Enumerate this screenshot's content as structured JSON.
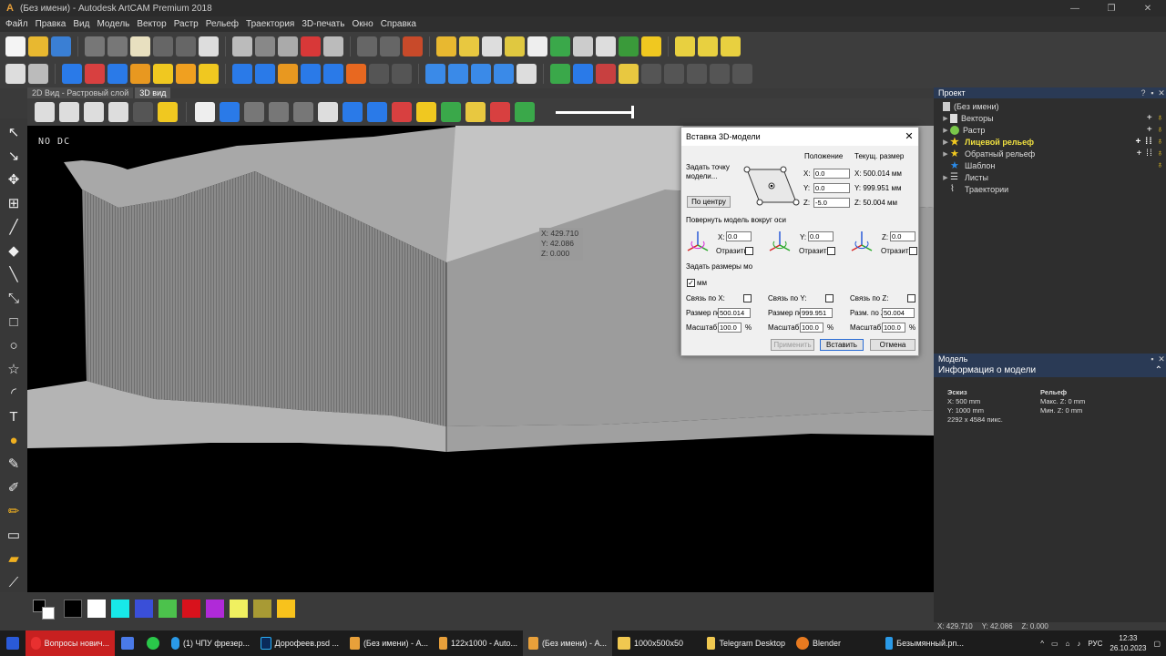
{
  "window": {
    "title": "(Без имени) - Autodesk ArtCAM Premium 2018",
    "minimize": "—",
    "maximize": "❐",
    "close": "✕"
  },
  "menu": [
    "Файл",
    "Правка",
    "Вид",
    "Модель",
    "Вектор",
    "Растр",
    "Рельеф",
    "Траектория",
    "3D-печать",
    "Окно",
    "Справка"
  ],
  "doc_tabs": [
    {
      "label": "2D Вид - Растровый слой"
    },
    {
      "label": "3D вид"
    }
  ],
  "viewport": {
    "label": "NO DC",
    "tooltip": {
      "x": "X: 429.710",
      "y": "Y: 42.086",
      "z": "Z: 0.000"
    }
  },
  "palette": {
    "colors": [
      "#ffffff",
      "#000000",
      "#ffffff",
      "#18e8e8",
      "#3a4fd8",
      "#4cc24c",
      "#d8121c",
      "#b02ad8",
      "#f0f060",
      "#a89a34",
      "#f8c21c"
    ]
  },
  "status": {
    "x": "X: 429.710",
    "y": "Y: 42.086",
    "z": "Z: 0.000"
  },
  "project": {
    "header": "Проект",
    "items": [
      {
        "label": "(Без имени)"
      },
      {
        "label": "Векторы"
      },
      {
        "label": "Растр"
      },
      {
        "label": "Лицевой рельеф"
      },
      {
        "label": "Обратный рельеф"
      },
      {
        "label": "Шаблон"
      },
      {
        "label": "Листы"
      },
      {
        "label": "Траектории"
      }
    ]
  },
  "model_panel": {
    "header": "Модель",
    "info_title": "Информация о модели",
    "sketch": {
      "title": "Эскиз",
      "x": "X: 500 mm",
      "y": "Y: 1000 mm",
      "pixels": "2292 x 4584 пикс."
    },
    "relief": {
      "title": "Рельеф",
      "max": "Макс. Z: 0 mm",
      "min": "Мин. Z: 0 mm"
    }
  },
  "dialog": {
    "title": "Вставка 3D-модели",
    "set_point": "Задать точку модели...",
    "center_btn": "По центру",
    "position_hdr": "Положение",
    "size_hdr": "Текущ. размер",
    "pos": {
      "x_lbl": "X:",
      "y_lbl": "Y:",
      "z_lbl": "Z:",
      "x": "0.0",
      "y": "0.0",
      "z": "-5.0"
    },
    "size": {
      "x": "X: 500.014 мм",
      "y": "Y: 999.951 мм",
      "z": "Z: 50.004 мм"
    },
    "rotate_lbl": "Повернуть модель вокруг оси",
    "rot": {
      "x_lbl": "X:",
      "y_lbl": "Y:",
      "z_lbl": "Z:",
      "x": "0.0",
      "y": "0.0",
      "z": "0.0",
      "mirror": "Отразить"
    },
    "dims_lbl": "Задать размеры мо",
    "mm_lbl": "мм",
    "link_x": "Связь по X:",
    "link_y": "Связь по Y:",
    "link_z": "Связь по Z:",
    "size_x_lbl": "Размер по",
    "size_y_lbl": "Размер по",
    "size_z_lbl": "Разм. по Z",
    "size_x": "500.014",
    "size_y": "999.951",
    "size_z": "50.004",
    "scale_lbl": "Масштаб г",
    "scale_x": "100.0",
    "scale_y": "100.0",
    "scale_z": "100.0",
    "pct": "%",
    "apply": "Применить",
    "insert": "Вставить",
    "cancel": "Отмена"
  },
  "taskbar": {
    "items": [
      {
        "label": "Вопросы нович..."
      },
      {
        "label": "(1) ЧПУ фрезер..."
      },
      {
        "label": "Дорофеев.psd ..."
      },
      {
        "label": "(Без имени) - А..."
      },
      {
        "label": "122x1000 - Auto..."
      },
      {
        "label": "(Без имени) - А..."
      },
      {
        "label": "1000x500x50"
      },
      {
        "label": "Telegram Desktop"
      },
      {
        "label": "Blender"
      },
      {
        "label": "Безымянный.pn..."
      }
    ],
    "lang": "РУС",
    "time": "12:33",
    "date": "26.10.2023"
  }
}
